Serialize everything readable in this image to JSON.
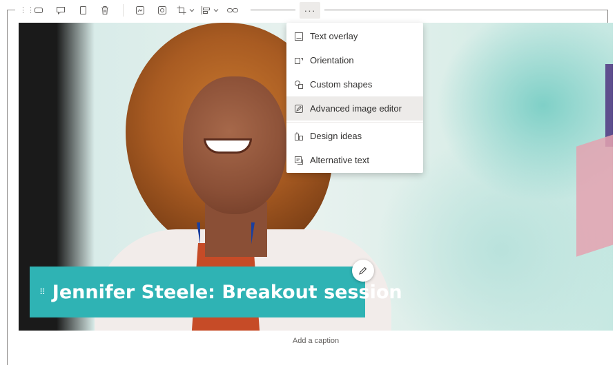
{
  "toolbar": {
    "buttons": [
      "move-handle",
      "resize",
      "comment",
      "copy",
      "delete",
      "edit-image",
      "reset-image",
      "crop",
      "align",
      "link"
    ],
    "more_label": "···"
  },
  "menu": {
    "items": [
      {
        "label": "Text overlay",
        "icon": "text-overlay-icon"
      },
      {
        "label": "Orientation",
        "icon": "orientation-icon"
      },
      {
        "label": "Custom shapes",
        "icon": "custom-shapes-icon"
      },
      {
        "label": "Advanced image editor",
        "icon": "image-editor-icon",
        "active": true
      },
      {
        "label": "Design ideas",
        "icon": "design-ideas-icon"
      },
      {
        "label": "Alternative text",
        "icon": "alt-text-icon"
      }
    ]
  },
  "overlay": {
    "title": "Jennifer Steele: Breakout session",
    "grip": "⠿"
  },
  "caption": {
    "placeholder": "Add a caption"
  },
  "colors": {
    "overlay_bg": "#2fb3b4",
    "menu_active": "#edebe9",
    "frame": "#8a8886"
  }
}
